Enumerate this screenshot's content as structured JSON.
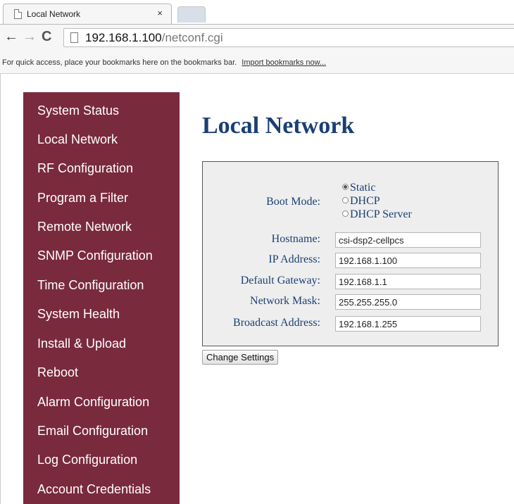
{
  "browser": {
    "tab_title": "Local Network",
    "tab_close": "×",
    "nav": {
      "back": "←",
      "forward": "→",
      "reload": "C"
    },
    "url_host": "192.168.1.100",
    "url_path": "/netconf.cgi",
    "bookmarks_text": "For quick access, place your bookmarks here on the bookmarks bar.",
    "bookmarks_link": "Import bookmarks now..."
  },
  "sidebar": {
    "items": [
      {
        "label": "System Status"
      },
      {
        "label": "Local Network"
      },
      {
        "label": "RF Configuration"
      },
      {
        "label": "Program a Filter"
      },
      {
        "label": "Remote Network"
      },
      {
        "label": "SNMP Configuration"
      },
      {
        "label": "Time Configuration"
      },
      {
        "label": "System Health"
      },
      {
        "label": "Install & Upload"
      },
      {
        "label": "Reboot"
      },
      {
        "label": "Alarm Configuration"
      },
      {
        "label": "Email Configuration"
      },
      {
        "label": "Log Configuration"
      },
      {
        "label": "Account Credentials"
      }
    ]
  },
  "main": {
    "title": "Local Network",
    "form": {
      "boot_mode_label": "Boot Mode:",
      "boot_mode_options": [
        {
          "label": "Static",
          "selected": true
        },
        {
          "label": "DHCP",
          "selected": false
        },
        {
          "label": "DHCP Server",
          "selected": false
        }
      ],
      "hostname_label": "Hostname:",
      "hostname_value": "csi-dsp2-cellpcs",
      "ip_label": "IP Address:",
      "ip_value": "192.168.1.100",
      "gateway_label": "Default Gateway:",
      "gateway_value": "192.168.1.1",
      "mask_label": "Network Mask:",
      "mask_value": "255.255.255.0",
      "broadcast_label": "Broadcast Address:",
      "broadcast_value": "192.168.1.255"
    },
    "submit_label": "Change Settings"
  },
  "colors": {
    "sidebar_bg": "#7a2a3d",
    "heading": "#1b3f73",
    "panel_bg": "#eeeeee"
  }
}
